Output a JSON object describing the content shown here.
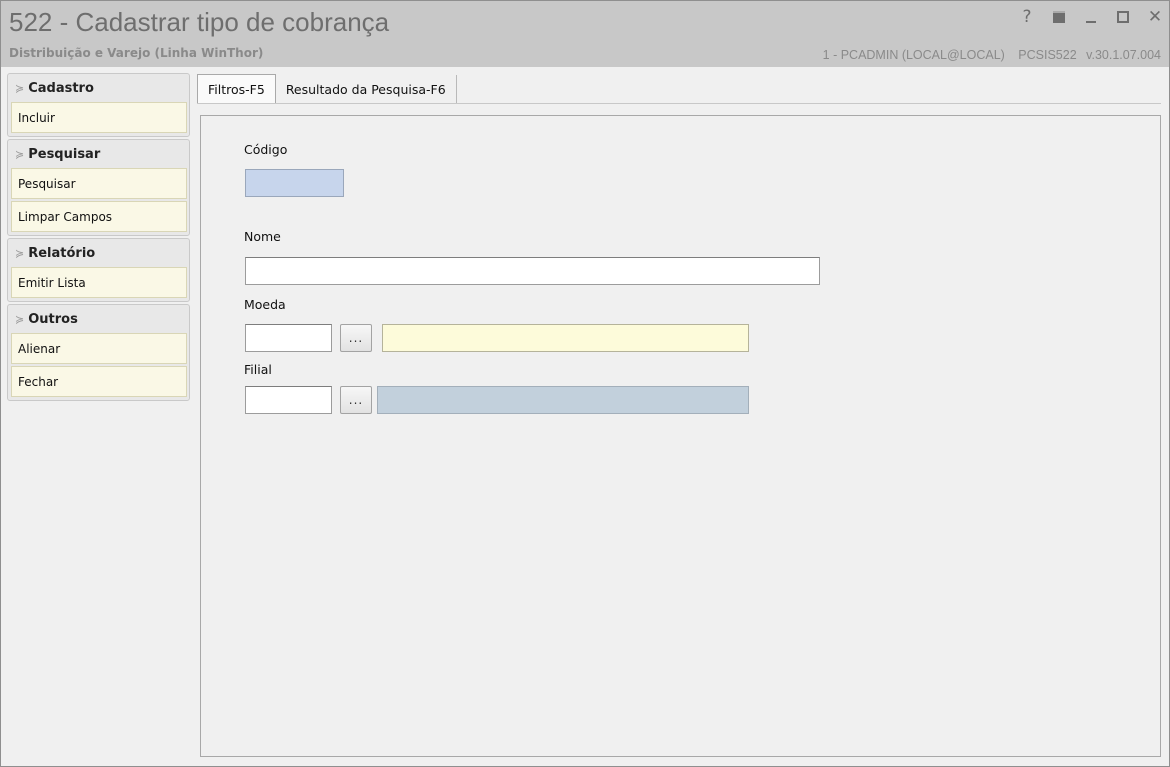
{
  "window": {
    "title": "522 - Cadastrar tipo de cobrança",
    "subtitle": "Distribuição e Varejo (Linha WinThor)",
    "user": "1 - PCADMIN (LOCAL@LOCAL)",
    "program": "PCSIS522",
    "version": "v.30.1.07.004",
    "help_glyph": "?",
    "close_glyph": "✕"
  },
  "sidebar": {
    "groups": [
      {
        "title": "Cadastro",
        "items": [
          "Incluir"
        ]
      },
      {
        "title": "Pesquisar",
        "items": [
          "Pesquisar",
          "Limpar Campos"
        ]
      },
      {
        "title": "Relatório",
        "items": [
          "Emitir Lista"
        ]
      },
      {
        "title": "Outros",
        "items": [
          "Alienar",
          "Fechar"
        ]
      }
    ],
    "chevron": "≽"
  },
  "tabs": [
    {
      "label": "Filtros-F5",
      "active": true
    },
    {
      "label": "Resultado da Pesquisa-F6",
      "active": false
    }
  ],
  "form": {
    "codigo_label": "Código",
    "codigo_value": "",
    "nome_label": "Nome",
    "nome_value": "",
    "moeda_label": "Moeda",
    "moeda_code": "",
    "moeda_desc": "",
    "filial_label": "Filial",
    "filial_code": "",
    "filial_desc": "",
    "lookup_button": "..."
  },
  "colors": {
    "titlebar": "#c8c8c8",
    "action_bg": "#faf8e6",
    "code_field": "#c7d5ec",
    "moeda_desc_field": "#fdfbda",
    "filial_desc_field": "#c2d0dc"
  }
}
